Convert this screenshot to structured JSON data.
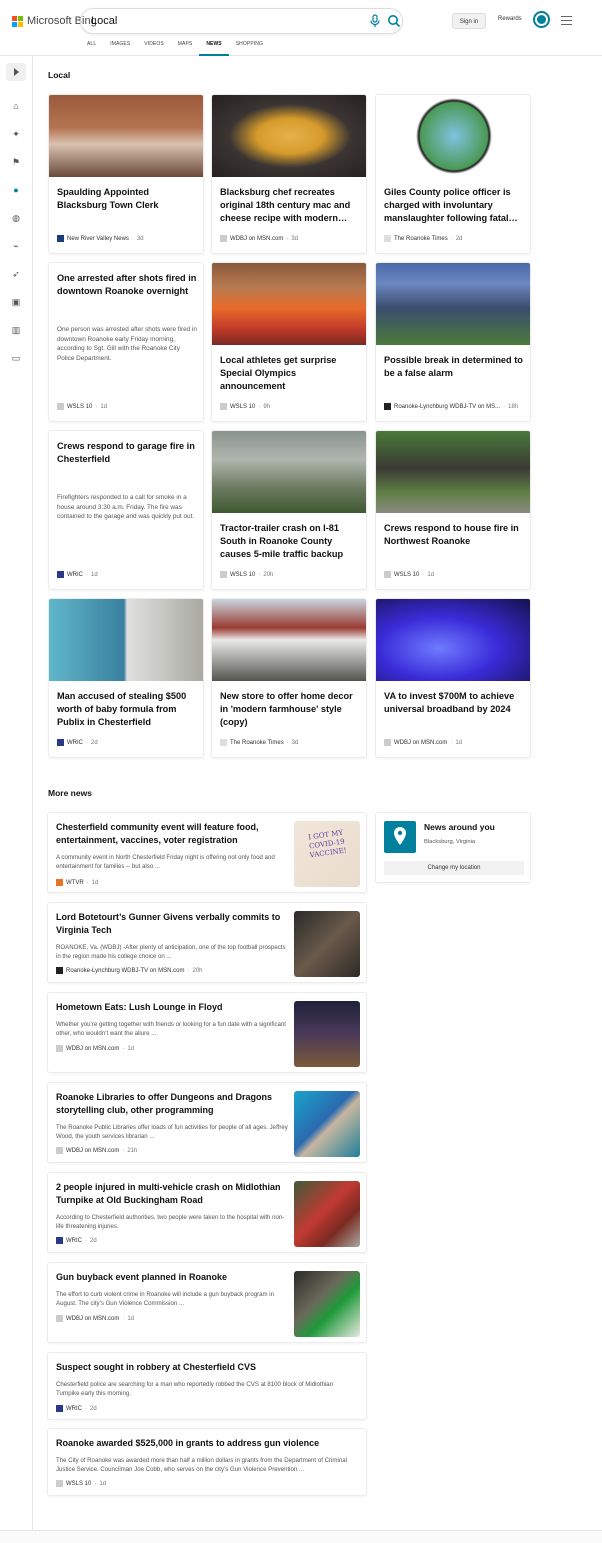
{
  "brand": {
    "name": "Microsoft Bing",
    "colors": [
      "#f25022",
      "#7fba00",
      "#00a4ef",
      "#ffb900"
    ],
    "accent": "#00809d"
  },
  "search": {
    "query": "Local"
  },
  "header": {
    "sign_in": "Sign in",
    "rewards": "Rewards"
  },
  "tabs": [
    {
      "label": "ALL",
      "active": false
    },
    {
      "label": "IMAGES",
      "active": false
    },
    {
      "label": "VIDEOS",
      "active": false
    },
    {
      "label": "MAPS",
      "active": false
    },
    {
      "label": "NEWS",
      "active": true
    },
    {
      "label": "SHOPPING",
      "active": false
    }
  ],
  "sidebar": {
    "icons": [
      "expand-icon",
      "home-icon",
      "satellite-icon",
      "flag-icon",
      "location-icon",
      "globe-icon",
      "chart-icon",
      "rocket-icon",
      "video-icon",
      "bank-icon",
      "card-icon"
    ]
  },
  "local": {
    "heading": "Local",
    "cards": [
      {
        "title": "Spaulding Appointed Blacksburg Town Clerk",
        "source": "New River Valley News",
        "age": "3d",
        "has_image": true
      },
      {
        "title": "Blacksburg chef recreates original 18th century mac and cheese recipe with modern…",
        "source": "WDBJ on MSN.com",
        "age": "3d",
        "has_image": true
      },
      {
        "title": "Giles County police officer is charged with involuntary manslaughter following fatal…",
        "source": "The Roanoke Times",
        "age": "2d",
        "has_image": true
      },
      {
        "title": "One arrested after shots fired in downtown Roanoke overnight",
        "snippet": "One person was arrested after shots were fired in downtown Roanoke early Friday morning, according to Sgt. Gill with the Roanoke City Police Department.",
        "source": "WSLS 10",
        "age": "1d",
        "has_image": false
      },
      {
        "title": "Local athletes get surprise Special Olympics announcement",
        "source": "WSLS 10",
        "age": "9h",
        "has_image": true
      },
      {
        "title": "Possible break in determined to be a false alarm",
        "source": "Roanoke-Lynchburg WDBJ-TV on MS...",
        "age": "18h",
        "has_image": true
      },
      {
        "title": "Crews respond to garage fire in Chesterfield",
        "snippet": "Firefighters responded to a call for smoke in a house around 3:30 a.m. Friday. The fire was contained to the garage and was quickly put out.",
        "source": "WRIC",
        "age": "1d",
        "has_image": false
      },
      {
        "title": "Tractor-trailer crash on I-81 South in Roanoke County causes 5-mile traffic backup",
        "source": "WSLS 10",
        "age": "20h",
        "has_image": true
      },
      {
        "title": "Crews respond to house fire in Northwest Roanoke",
        "source": "WSLS 10",
        "age": "1d",
        "has_image": true
      },
      {
        "title": "Man accused of stealing $500 worth of baby formula from Publix in Chesterfield",
        "source": "WRIC",
        "age": "2d",
        "has_image": true
      },
      {
        "title": "New store to offer home decor in 'modern farmhouse' style (copy)",
        "source": "The Roanoke Times",
        "age": "3d",
        "has_image": true
      },
      {
        "title": "VA to invest $700M to achieve universal broadband by 2024",
        "source": "WDBJ on MSN.com",
        "age": "1d",
        "has_image": true
      }
    ]
  },
  "more_news": {
    "heading": "More news",
    "items": [
      {
        "title": "Chesterfield community event will feature food, entertainment, vaccines, voter registration",
        "snippet": "A community event in North Chesterfield Friday night is offering not only food and entertainment for families -- but also ...",
        "source": "WTVR",
        "age": "1d"
      },
      {
        "title": "Lord Botetourt’s Gunner Givens verbally commits to Virginia Tech",
        "snippet": "ROANOKE, Va. (WDBJ) -After plenty of anticipation, one of the top football prospects in the region made his college choice on ...",
        "source": "Roanoke-Lynchburg WDBJ-TV on MSN.com",
        "age": "20h"
      },
      {
        "title": "Hometown Eats: Lush Lounge in Floyd",
        "snippet": "Whether you’re getting together with friends or looking for a fun date with a significant other, who wouldn’t want the allure ...",
        "source": "WDBJ on MSN.com",
        "age": "1d"
      },
      {
        "title": "Roanoke Libraries to offer Dungeons and Dragons storytelling club, other programming",
        "snippet": "The Roanoke Public Libraries offer loads of fun activities for people of all ages. Jeffrey Wood, the youth services librarian ...",
        "source": "WDBJ on MSN.com",
        "age": "21h"
      },
      {
        "title": "2 people injured in multi-vehicle crash on Midlothian Turnpike at Old Buckingham Road",
        "snippet": "According to Chesterfield authorities, two people were taken to the hospital with non-life threatening injuries.",
        "source": "WRIC",
        "age": "2d"
      },
      {
        "title": "Gun buyback event planned in Roanoke",
        "snippet": "The effort to curb violent crime in Roanoke will include a gun buyback program in August. The city’s Gun Violence Commission ...",
        "source": "WDBJ on MSN.com",
        "age": "1d"
      },
      {
        "title": "Suspect sought in robbery at Chesterfield CVS",
        "snippet": "Chesterfield police are searching for a man who reportedly robbed the CVS at 8100 block of Midlothian Turnpike early this morning.",
        "source": "WRIC",
        "age": "2d"
      },
      {
        "title": "Roanoke awarded $525,000 in grants to address gun violence",
        "snippet": "The City of Roanoke was awarded more than half a million dollars in grants from the Department of Criminal Justice Service. Councilman Joe Cobb, who serves on the city’s Gun Violence Prevention ...",
        "source": "WSLS 10",
        "age": "1d"
      }
    ],
    "thumb_text": "I GOT MY COVID-19 VACCINE!"
  },
  "around": {
    "title": "News around you",
    "location": "Blacksburg, Virginia",
    "button": "Change my location"
  }
}
